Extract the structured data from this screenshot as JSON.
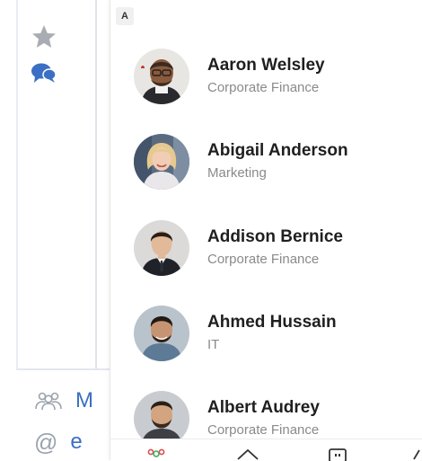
{
  "background_app": {
    "sidebar_items": [
      {
        "icon": "star-icon"
      },
      {
        "icon": "chat-icon"
      }
    ],
    "bottom_items": [
      {
        "icon": "people-icon",
        "label": "M"
      },
      {
        "icon": "at-icon",
        "glyph": "@",
        "label": "e"
      }
    ]
  },
  "contacts_panel": {
    "section_letter": "A",
    "contacts": [
      {
        "name": "Aaron Welsley",
        "department": "Corporate Finance"
      },
      {
        "name": "Abigail Anderson",
        "department": "Marketing"
      },
      {
        "name": "Addison Bernice",
        "department": "Corporate Finance"
      },
      {
        "name": "Ahmed Hussain",
        "department": "IT"
      },
      {
        "name": "Albert Audrey",
        "department": "Corporate Finance"
      }
    ]
  },
  "tabbar": {
    "tabs": [
      {
        "icon": "people-tab-icon"
      },
      {
        "icon": "home-tab-icon"
      },
      {
        "icon": "calendar-tab-icon"
      },
      {
        "icon": "more-tab-icon"
      }
    ]
  },
  "colors": {
    "accent_blue": "#3a6fc4",
    "sidebar_border": "#dfe3ea",
    "name_text": "#1f1f1f",
    "dept_text": "#8a8a8a"
  }
}
